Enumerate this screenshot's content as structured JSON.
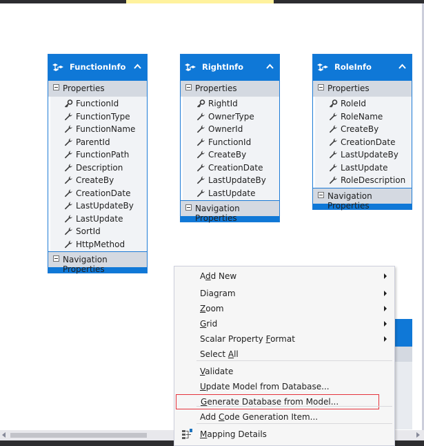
{
  "entities": [
    {
      "title": "FunctionInfo",
      "section_properties": "Properties",
      "section_navigation": "Navigation Properties",
      "properties": [
        {
          "name": "FunctionId",
          "key": true
        },
        {
          "name": "FunctionType",
          "key": false
        },
        {
          "name": "FunctionName",
          "key": false
        },
        {
          "name": "ParentId",
          "key": false
        },
        {
          "name": "FunctionPath",
          "key": false
        },
        {
          "name": "Description",
          "key": false
        },
        {
          "name": "CreateBy",
          "key": false
        },
        {
          "name": "CreationDate",
          "key": false
        },
        {
          "name": "LastUpdateBy",
          "key": false
        },
        {
          "name": "LastUpdate",
          "key": false
        },
        {
          "name": "SortId",
          "key": false
        },
        {
          "name": "HttpMethod",
          "key": false
        }
      ]
    },
    {
      "title": "RightInfo",
      "section_properties": "Properties",
      "section_navigation": "Navigation Properties",
      "properties": [
        {
          "name": "RightId",
          "key": true
        },
        {
          "name": "OwnerType",
          "key": false
        },
        {
          "name": "OwnerId",
          "key": false
        },
        {
          "name": "FunctionId",
          "key": false
        },
        {
          "name": "CreateBy",
          "key": false
        },
        {
          "name": "CreationDate",
          "key": false
        },
        {
          "name": "LastUpdateBy",
          "key": false
        },
        {
          "name": "LastUpdate",
          "key": false
        }
      ]
    },
    {
      "title": "RoleInfo",
      "section_properties": "Properties",
      "section_navigation": "Navigation Properties",
      "properties": [
        {
          "name": "RoleId",
          "key": true
        },
        {
          "name": "RoleName",
          "key": false
        },
        {
          "name": "CreateBy",
          "key": false
        },
        {
          "name": "CreationDate",
          "key": false
        },
        {
          "name": "LastUpdateBy",
          "key": false
        },
        {
          "name": "LastUpdate",
          "key": false
        },
        {
          "name": "RoleDescription",
          "key": false
        }
      ]
    }
  ],
  "context_menu": {
    "items": [
      {
        "pre": "A",
        "u": "d",
        "post": "d New",
        "submenu": true
      },
      {
        "pre": "Dia",
        "u": "g",
        "post": "ram",
        "submenu": true
      },
      {
        "pre": "",
        "u": "Z",
        "post": "oom",
        "submenu": true
      },
      {
        "pre": "",
        "u": "G",
        "post": "rid",
        "submenu": true
      },
      {
        "pre": "Scalar Property ",
        "u": "F",
        "post": "ormat",
        "submenu": true
      },
      {
        "pre": "Select ",
        "u": "A",
        "post": "ll",
        "submenu": false
      },
      {
        "pre": "",
        "u": "V",
        "post": "alidate",
        "submenu": false
      },
      {
        "pre": "",
        "u": "U",
        "post": "pdate Model from Database...",
        "submenu": false
      },
      {
        "pre": "",
        "u": "G",
        "post": "enerate Database from Model...",
        "submenu": false,
        "highlighted": true
      },
      {
        "pre": "Add ",
        "u": "C",
        "post": "ode Generation Item...",
        "submenu": false
      },
      {
        "pre": "",
        "u": "M",
        "post": "apping Details",
        "submenu": false,
        "icon": "mapping-details-icon"
      }
    ]
  },
  "colors": {
    "entity_header": "#0f78d7",
    "section_header": "#d4d9e1",
    "highlight_outline": "#e5323b",
    "menu_background": "#f6f6f6"
  }
}
